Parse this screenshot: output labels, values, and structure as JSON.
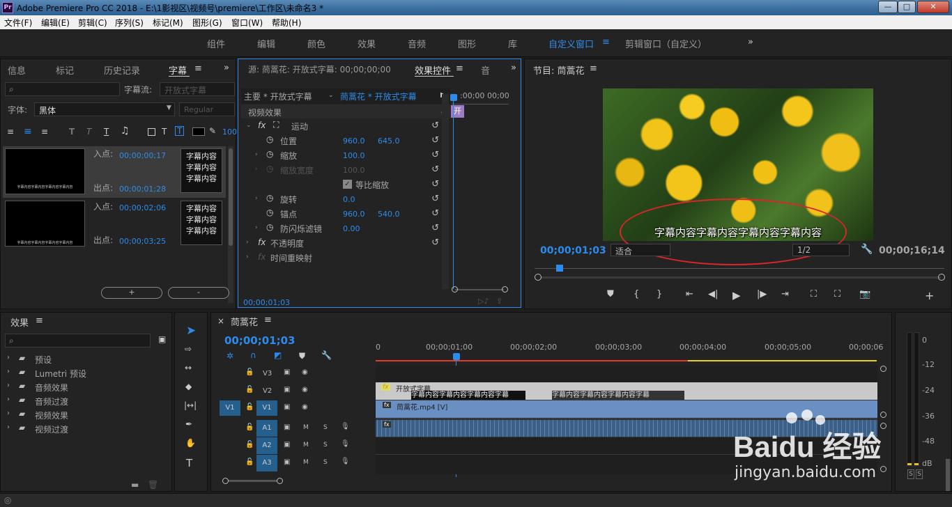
{
  "app": {
    "title": "Adobe Premiere Pro CC 2018 - E:\\1影视区\\视频号\\premiere\\工作区\\未命名3 *",
    "icon_text": "Pr"
  },
  "window_controls": {
    "minimize": "—",
    "maximize": "□",
    "close": "✕"
  },
  "menu": [
    "文件(F)",
    "编辑(E)",
    "剪辑(C)",
    "序列(S)",
    "标记(M)",
    "图形(G)",
    "窗口(W)",
    "帮助(H)"
  ],
  "workspaces": {
    "items": [
      "组件",
      "编辑",
      "颜色",
      "效果",
      "音频",
      "图形",
      "库"
    ],
    "active": "自定义窗口",
    "custom": "剪辑窗口（自定义）",
    "more": "»"
  },
  "left_top_panel": {
    "tabs": [
      "信息",
      "标记",
      "历史记录",
      "字幕"
    ],
    "active_tab": "字幕",
    "caption_stream_label": "字幕流:",
    "caption_stream_value": "开放式字幕",
    "font_label": "字体:",
    "font_value": "黑体",
    "style_value": "Regular",
    "size_value": "100",
    "captions": [
      {
        "in_label": "入点:",
        "in_time": "00;00;00;17",
        "out_label": "出点:",
        "out_time": "00;00;01;28",
        "text": "字幕内容\n字幕内容\n字幕内容",
        "thumb_text": "字幕内容字幕内容字幕内容字幕内容"
      },
      {
        "in_label": "入点:",
        "in_time": "00;00;02;06",
        "out_label": "出点:",
        "out_time": "00;00;03;25",
        "text": "字幕内容\n字幕内容\n字幕内容",
        "thumb_text": "字幕内容字幕内容字幕内容字幕内容"
      }
    ],
    "add_btn": "+",
    "remove_btn": "-"
  },
  "effect_controls": {
    "source_tab": "源: 茼蒿花: 开放式字幕: 00;00;00;00",
    "active_tab": "效果控件",
    "next_tab": "音",
    "master_label": "主要 * 开放式字幕",
    "sequence_label": "茼蒿花 * 开放式字幕",
    "time_start": ":00;00",
    "time_next": "00;00",
    "clip_marker": "开",
    "section": "视频效果",
    "rows": [
      {
        "name": "运动",
        "type": "fx"
      },
      {
        "name": "位置",
        "v1": "960.0",
        "v2": "645.0"
      },
      {
        "name": "缩放",
        "v1": "100.0"
      },
      {
        "name": "缩放宽度",
        "v1": "100.0",
        "disabled": true
      },
      {
        "name": "等比缩放",
        "type": "checkbox"
      },
      {
        "name": "旋转",
        "v1": "0.0"
      },
      {
        "name": "锚点",
        "v1": "960.0",
        "v2": "540.0"
      },
      {
        "name": "防闪烁滤镜",
        "v1": "0.00"
      },
      {
        "name": "不透明度",
        "type": "fx"
      },
      {
        "name": "时间重映射",
        "type": "fx"
      }
    ],
    "timecode": "00;00;01;03"
  },
  "program_monitor": {
    "title": "节目: 茼蒿花",
    "subtitle": "字幕内容字幕内容字幕内容字幕内容",
    "current_time": "00;00;01;03",
    "fit": "适合",
    "quality": "1/2",
    "duration": "00;00;16;14"
  },
  "effects_panel": {
    "title": "效果",
    "items": [
      "预设",
      "Lumetri 预设",
      "音频效果",
      "音频过渡",
      "视频效果",
      "视频过渡"
    ]
  },
  "timeline": {
    "sequence": "茼蒿花",
    "timecode": "00;00;01;03",
    "ruler": [
      "0",
      "00;00;01;00",
      "00;00;02;00",
      "00;00;03;00",
      "00;00;04;00",
      "00;00;05;00",
      "00;00;06"
    ],
    "tracks": {
      "video": [
        {
          "name": "V3"
        },
        {
          "name": "V2"
        },
        {
          "name": "V1",
          "source": "V1"
        }
      ],
      "audio": [
        {
          "name": "A1"
        },
        {
          "name": "A2"
        },
        {
          "name": "A3"
        }
      ],
      "mute": "M",
      "solo": "S"
    },
    "clips": {
      "caption_track": "开放式字幕",
      "caption1": "字幕内容字幕内容字幕内容字幕",
      "caption2": "字幕内容字幕内容字幕内容字幕",
      "video": "茼蒿花.mp4 [V]"
    }
  },
  "meter": {
    "labels": [
      "0",
      "-12",
      "-24",
      "-36",
      "-48",
      "dB"
    ],
    "solo": [
      "S",
      "S"
    ]
  },
  "watermark": {
    "brand": "Baidu 经验",
    "url": "jingyan.baidu.com"
  }
}
